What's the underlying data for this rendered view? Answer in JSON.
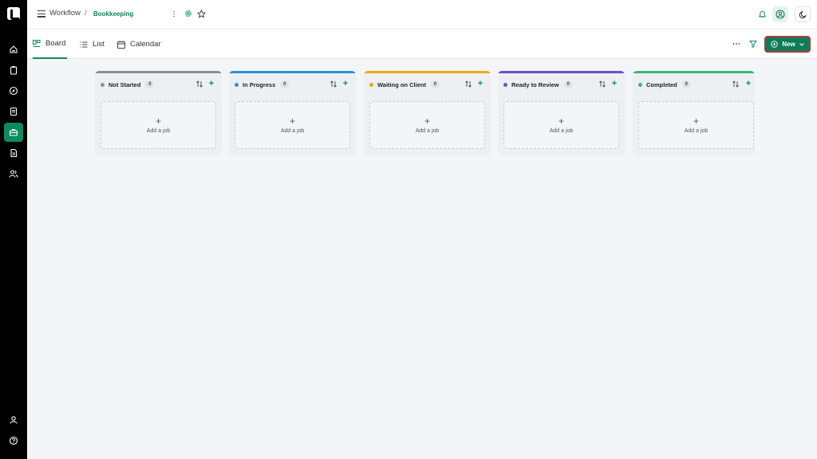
{
  "breadcrumb": {
    "root": "Workflow",
    "separator": "/",
    "current": "Bookkeeping"
  },
  "tabs": [
    {
      "label": "Board",
      "icon": "board-icon"
    },
    {
      "label": "List",
      "icon": "list-icon"
    },
    {
      "label": "Calendar",
      "icon": "calendar-icon"
    }
  ],
  "toolbar": {
    "new_label": "New"
  },
  "columns": [
    {
      "name": "Not Started",
      "count": "0",
      "color": "#8a8f98",
      "add_label": "Add a job"
    },
    {
      "name": "In Progress",
      "count": "0",
      "color": "#2f8fd8",
      "add_label": "Add a job"
    },
    {
      "name": "Waiting on Client",
      "count": "0",
      "color": "#f0a81c",
      "add_label": "Add a job"
    },
    {
      "name": "Ready to Review",
      "count": "0",
      "color": "#6a4fd0",
      "add_label": "Add a job"
    },
    {
      "name": "Completed",
      "count": "0",
      "color": "#3cb86a",
      "add_label": "Add a job"
    }
  ],
  "colors": {
    "accent": "#0e8a5f",
    "new_button_border": "#b5383c"
  },
  "sidebar_icons": [
    "home-icon",
    "clipboard-icon",
    "compass-icon",
    "document-icon",
    "briefcase-icon",
    "file-icon",
    "users-icon",
    "user-icon",
    "help-icon"
  ]
}
